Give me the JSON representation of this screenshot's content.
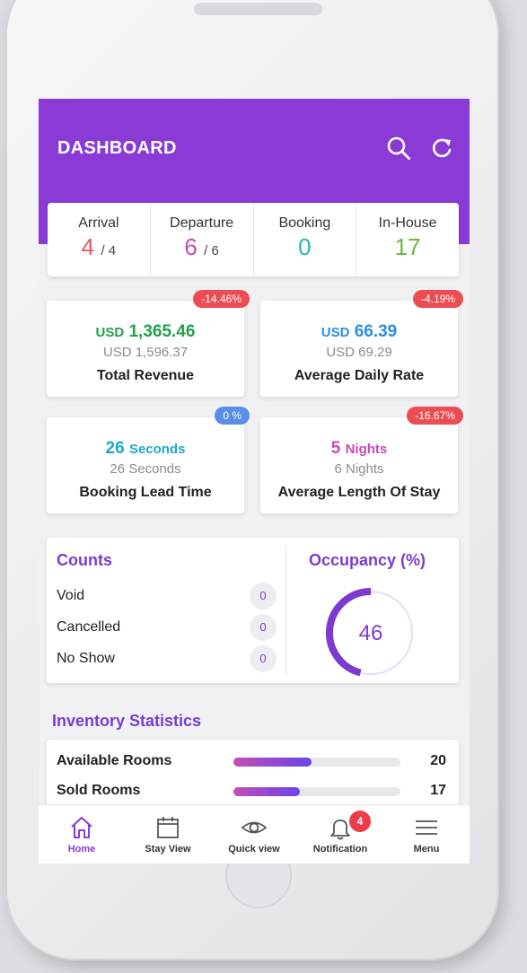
{
  "header": {
    "title": "DASHBOARD",
    "accent": "#8a3bd6"
  },
  "summary": [
    {
      "label": "Arrival",
      "value": "4",
      "total": "/ 4",
      "color": "#e8555f"
    },
    {
      "label": "Departure",
      "value": "6",
      "total": "/ 6",
      "color": "#c74bb8"
    },
    {
      "label": "Booking",
      "value": "0",
      "total": "",
      "color": "#27b3c4"
    },
    {
      "label": "In-House",
      "value": "17",
      "total": "",
      "color": "#69b83c"
    }
  ],
  "metrics": [
    {
      "unit": "USD",
      "value": "1,365.46",
      "sub": "USD 1,596.37",
      "label": "Total Revenue",
      "badge": "-14.46%",
      "badge_color": "red",
      "color": "#23a04a"
    },
    {
      "unit": "USD",
      "value": "66.39",
      "sub": "USD 69.29",
      "label": "Average Daily Rate",
      "badge": "-4.19%",
      "badge_color": "red",
      "color": "#2a8fe0"
    },
    {
      "value": "26",
      "unit": "Seconds",
      "sub": "26 Seconds",
      "label": "Booking Lead Time",
      "badge": "0 %",
      "badge_color": "blue",
      "color": "#1ea8c8"
    },
    {
      "value": "5",
      "unit": "Nights",
      "sub": "6 Nights",
      "label": "Average Length Of Stay",
      "badge": "-16.67%",
      "badge_color": "red",
      "color": "#c74bb8"
    }
  ],
  "counts": {
    "title": "Counts",
    "items": [
      {
        "label": "Void",
        "value": "0"
      },
      {
        "label": "Cancelled",
        "value": "0"
      },
      {
        "label": "No Show",
        "value": "0"
      }
    ]
  },
  "occupancy": {
    "title": "Occupancy (%)",
    "value": "46",
    "fraction": 0.46
  },
  "inventory": {
    "title": "Inventory Statistics",
    "items": [
      {
        "label": "Available Rooms",
        "value": "20",
        "fill": 0.47
      },
      {
        "label": "Sold Rooms",
        "value": "17",
        "fill": 0.4
      }
    ]
  },
  "nav": [
    {
      "label": "Home",
      "icon": "home-icon",
      "active": true
    },
    {
      "label": "Stay View",
      "icon": "calendar-icon",
      "active": false
    },
    {
      "label": "Quick view",
      "icon": "eye-icon",
      "active": false
    },
    {
      "label": "Notification",
      "icon": "bell-icon",
      "active": false,
      "badge": "4"
    },
    {
      "label": "Menu",
      "icon": "menu-icon",
      "active": false
    }
  ]
}
